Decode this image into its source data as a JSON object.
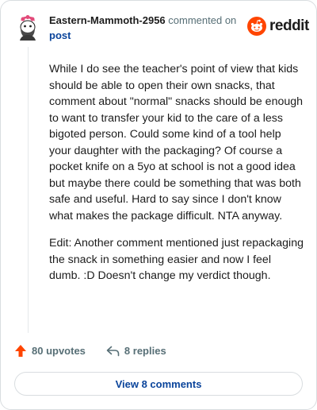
{
  "comment": {
    "username": "Eastern-Mammoth-2956",
    "commented_on_text": "commented on",
    "post_link_text": "post",
    "paragraphs": [
      "While I do see the teacher's point of view that kids should be able to open their own snacks, that comment about \"normal\" snacks should be enough to want to transfer your kid to the care of a less bigoted person. Could some kind of a tool help your daughter with the packaging? Of course a pocket knife on a 5yo at school is not a good idea but maybe there could be something that was both safe and useful. Hard to say since I don't know what makes the package difficult. NTA anyway.",
      "Edit: Another comment mentioned just repackaging the snack in something easier and now I feel dumb. :D Doesn't change my verdict though."
    ]
  },
  "brand": {
    "wordmark": "reddit",
    "color": "#ff4500"
  },
  "actions": {
    "upvotes": "80 upvotes",
    "replies": "8 replies"
  },
  "view_comments_label": "View 8 comments",
  "icons": {
    "avatar": "avatar-icon",
    "logo": "reddit-logo-icon",
    "upvote": "upvote-arrow-icon",
    "reply": "reply-icon"
  }
}
